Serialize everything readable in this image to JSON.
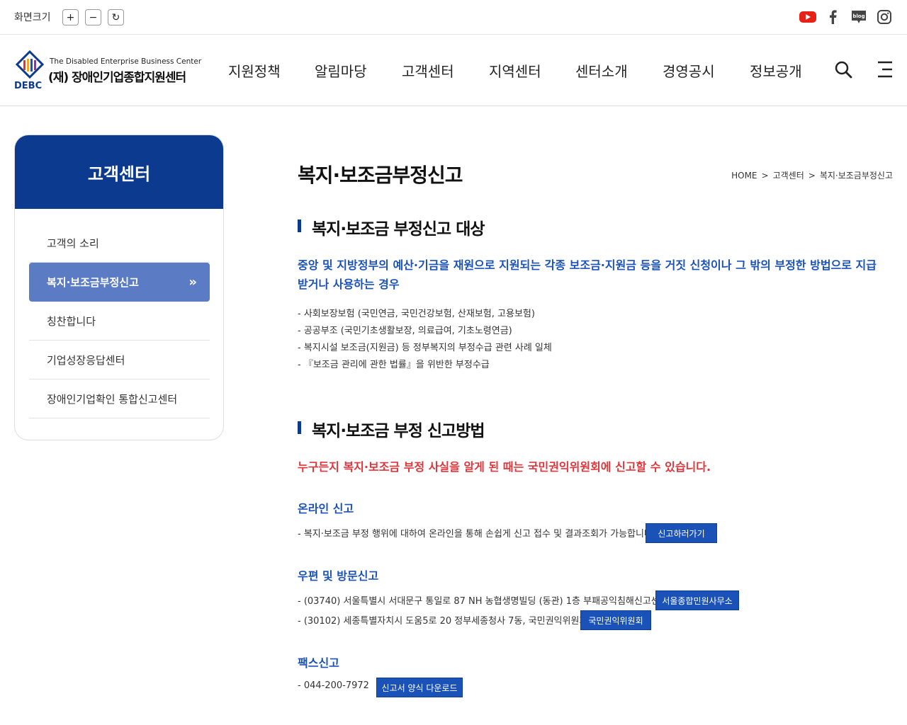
{
  "util": {
    "screen_size_label": "화면크기",
    "zoom_in": "+",
    "zoom_out": "−",
    "reset": "↻"
  },
  "logo": {
    "mark_text": "DEBC",
    "en": "The Disabled Enterprise Business Center",
    "ko": "(재) 장애인기업종합지원센터"
  },
  "nav": {
    "items": [
      "지원정책",
      "알림마당",
      "고객센터",
      "지역센터",
      "센터소개",
      "경영공시",
      "정보공개"
    ]
  },
  "icons": {
    "social": [
      "youtube-icon",
      "facebook-icon",
      "blog-icon",
      "instagram-icon"
    ],
    "blog_text": "blog",
    "header": [
      "search-icon",
      "menu-icon"
    ]
  },
  "sidebar": {
    "title": "고객센터",
    "items": [
      {
        "label": "고객의 소리",
        "active": false
      },
      {
        "label": "복지·보조금부정신고",
        "active": true
      },
      {
        "label": "칭찬합니다",
        "active": false
      },
      {
        "label": "기업성장응답센터",
        "active": false
      },
      {
        "label": "장애인기업확인 통합신고센터",
        "active": false
      }
    ],
    "active_chevron": "»"
  },
  "page": {
    "title": "복지·보조금부정신고",
    "breadcrumb": [
      "HOME",
      "고객센터",
      "복지·보조금부정신고"
    ],
    "breadcrumb_sep": ">"
  },
  "section1": {
    "title": "복지·보조금 부정신고 대상",
    "lead": "중앙 및 지방정부의 예산·기금을 재원으로 지원되는 각종 보조금·지원금 등을 거짓 신청이나 그 밖의 부정한 방법으로 지급받거나 사용하는 경우",
    "items": [
      "- 사회보장보험 (국민연금, 국민건강보험, 산재보험, 고용보험)",
      "- 공공부조 (국민기초생활보장, 의료급여, 기초노령연금)",
      "- 복지시설 보조금(지원금) 등 정부복지의 부정수급 관련 사례 일체",
      "- 『보조금 관리에 관한 법률』을 위반한 부정수급"
    ]
  },
  "section2": {
    "title": "복지·보조금 부정 신고방법",
    "lead": "누구든지 복지·보조금 부정 사실을 알게 된 때는 국민권익위원회에 신고할 수 있습니다.",
    "online": {
      "title": "온라인 신고",
      "text": "- 복지·보조금 부정 행위에 대하여 온라인을 통해 손쉽게 신고 접수 및 결과조회가 가능합니다.",
      "button": "신고하러가기"
    },
    "mail": {
      "title": "우편 및 방문신고",
      "rows": [
        {
          "text": "- (03740) 서울특별시 서대문구 통일로 87 NH 농협생명빌딩 (동관) 1층 부패공익침해신고센터",
          "button": "서울종합민원사무소"
        },
        {
          "text": "- (30102) 세종특별자치시 도움5로 20 정부세종청사 7동, 국민권익위원회",
          "button": "국민권익위원회"
        }
      ]
    },
    "fax": {
      "title": "팩스신고",
      "text": "- 044-200-7972",
      "button": "신고서 양식 다운로드"
    }
  },
  "colors": {
    "brand_navy": "#0b3a8f",
    "accent_blue": "#1b52b8",
    "sidebar_active": "#5b7bc4",
    "alert_red": "#e0353a",
    "youtube_red": "#e62117"
  }
}
